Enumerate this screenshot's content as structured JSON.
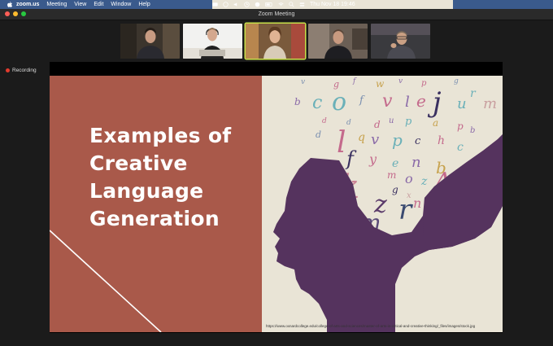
{
  "menubar": {
    "app_name": "zoom.us",
    "items": [
      "Meeting",
      "View",
      "Edit",
      "Window",
      "Help"
    ],
    "datetime": "Thu Nov 18  19:46"
  },
  "window": {
    "title": "Zoom Meeting"
  },
  "recording": {
    "label": "Recording"
  },
  "slide": {
    "title_lines": [
      "Examples of",
      "Creative",
      "Language",
      "Generation"
    ],
    "source_url": "https://www.oxnardcollege.edu/college-of-arts-and-sciences/master-of-arts-in-critical-and-creative-thinking/_files/images/stock.jpg"
  },
  "colors": {
    "slide_left": "#a9594a",
    "slide_right": "#e9e4d6",
    "head": "#55335e",
    "menubar": "#3a5a8c",
    "active_speaker": "#c8e04a"
  },
  "participants": [
    "participant-1",
    "participant-2",
    "participant-3",
    "participant-4",
    "participant-5"
  ],
  "icons": [
    "apple-icon",
    "wifi-icon",
    "battery-icon",
    "search-icon",
    "control-center-icon",
    "volume-icon",
    "clock-icon",
    "record-dot-icon"
  ]
}
